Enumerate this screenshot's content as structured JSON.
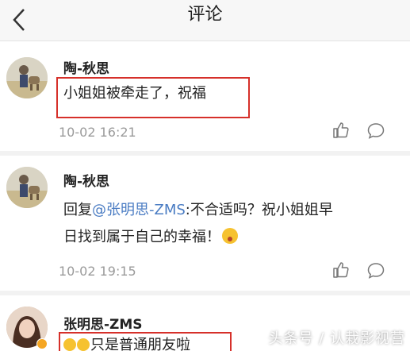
{
  "header": {
    "title": "评论"
  },
  "comments": [
    {
      "user": "陶-秋思",
      "text": "小姐姐被牵走了，祝福",
      "time": "10-02 16:21"
    },
    {
      "user": "陶-秋思",
      "reply_prefix": "回复",
      "mention": "@张明思-ZMS",
      "line1_rest": ":不合适吗？祝小姐姐早",
      "line2": "日找到属于自己的幸福！",
      "time": "10-02 19:15"
    },
    {
      "user": "张明思-ZMS",
      "text": "只是普通朋友啦"
    }
  ],
  "watermark": "头条号 / 认栽影视营",
  "colors": {
    "mention": "#4a7cc3",
    "highlight_box": "#d6302a",
    "time": "#9a9a9a"
  },
  "icons": [
    "back-arrow-icon",
    "like-icon",
    "comment-icon",
    "emoji-icon"
  ]
}
